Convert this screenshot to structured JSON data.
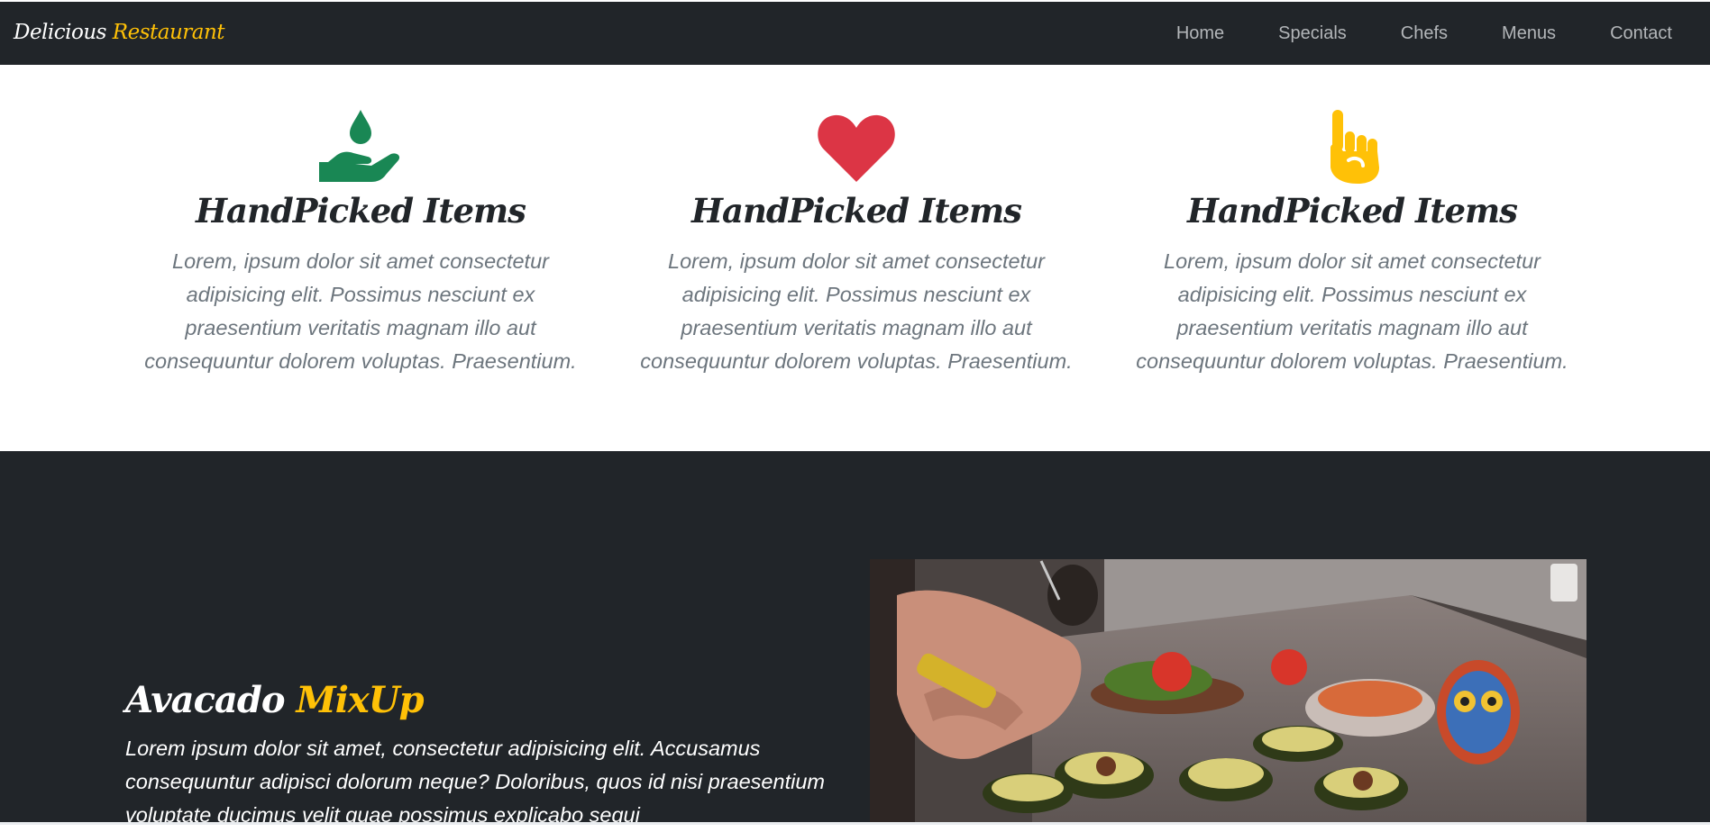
{
  "navbar": {
    "brand_main": "Delicious",
    "brand_accent": "Restaurant",
    "links": [
      "Home",
      "Specials",
      "Chefs",
      "Menus",
      "Contact"
    ]
  },
  "features": [
    {
      "icon": "hand-holding-droplet-icon",
      "icon_color": "#198754",
      "title": "HandPicked Items",
      "text": "Lorem, ipsum dolor sit amet consectetur adipisicing elit. Possimus nesciunt ex praesentium veritatis magnam illo aut consequuntur dolorem voluptas. Praesentium."
    },
    {
      "icon": "heart-icon",
      "icon_color": "#dc3545",
      "title": "HandPicked Items",
      "text": "Lorem, ipsum dolor sit amet consectetur adipisicing elit. Possimus nesciunt ex praesentium veritatis magnam illo aut consequuntur dolorem voluptas. Praesentium."
    },
    {
      "icon": "hand-pointing-up-icon",
      "icon_color": "#ffc107",
      "title": "HandPicked Items",
      "text": "Lorem, ipsum dolor sit amet consectetur adipisicing elit. Possimus nesciunt ex praesentium veritatis magnam illo aut consequuntur dolorem voluptas. Praesentium."
    }
  ],
  "dish": {
    "title_main": "Avacado",
    "title_accent": "MixUp",
    "text": "Lorem ipsum dolor sit amet, consectetur adipisicing elit. Accusamus consequuntur adipisci dolorum neque? Doloribus, quos id nisi praesentium voluptate ducimus velit quae possimus explicabo sequi",
    "photo": "avocado-preparation-photo"
  },
  "colors": {
    "dark": "#212529",
    "accent": "#ffc107"
  }
}
